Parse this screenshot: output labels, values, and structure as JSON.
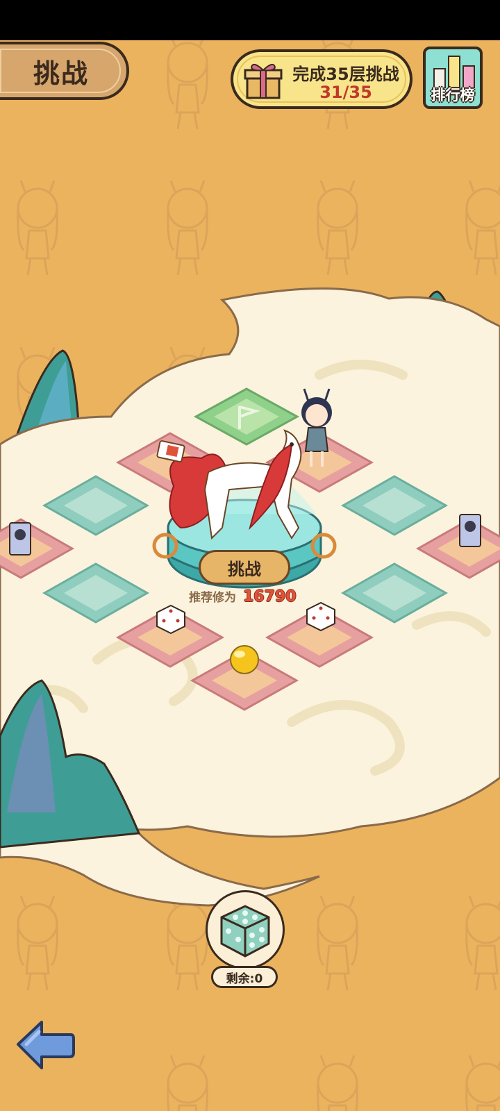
{
  "header": {
    "title": "挑战",
    "progress_text": "完成35层挑战",
    "progress_count": "31/35",
    "leaderboard_label": "排行榜"
  },
  "board": {
    "challenge_button": "挑战",
    "recommend_label": "推荐修为",
    "recommend_value": "16790",
    "card_glyph": "非"
  },
  "dice": {
    "remaining_label": "剩余:0"
  },
  "colors": {
    "background": "#EBB35E",
    "tile_pink": "#E7A0A0",
    "tile_green": "#8FCDBE",
    "cloud": "#FBF3DD"
  }
}
